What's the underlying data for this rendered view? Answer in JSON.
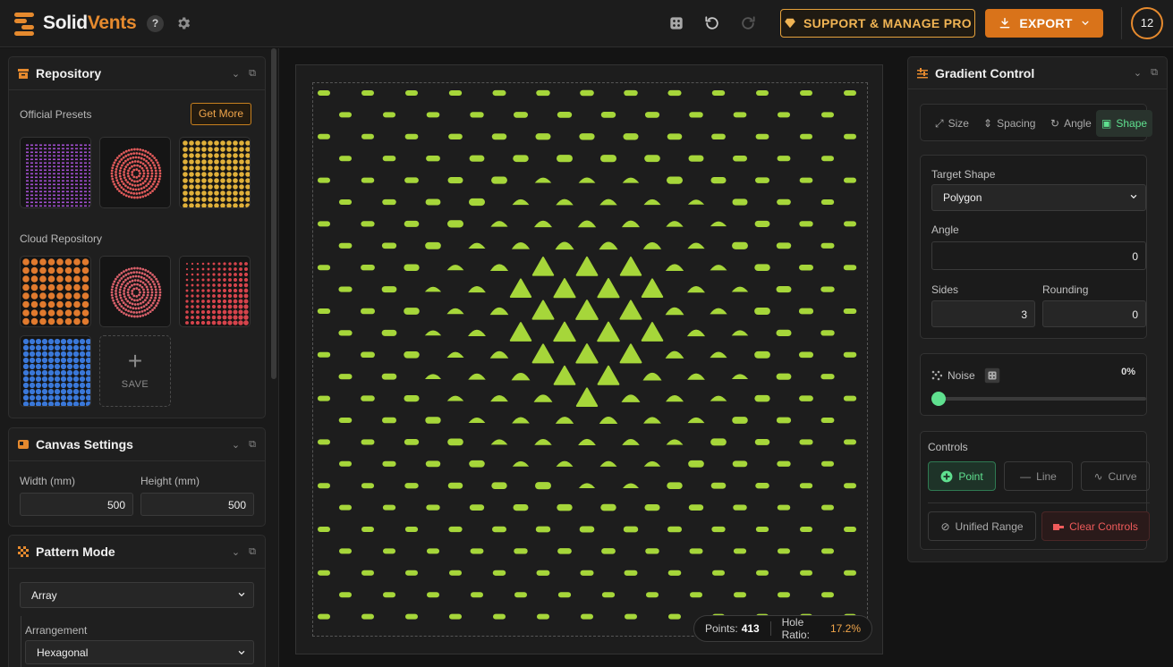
{
  "app": {
    "name_a": "Solid",
    "name_b": "Vents",
    "help": "?",
    "notification_count": "12"
  },
  "toolbar": {
    "support_label": "SUPPORT & MANAGE PRO",
    "export_label": "EXPORT"
  },
  "repository": {
    "title": "Repository",
    "official_label": "Official Presets",
    "get_more": "Get More",
    "cloud_label": "Cloud Repository",
    "save_label": "SAVE"
  },
  "canvas_settings": {
    "title": "Canvas Settings",
    "width_label": "Width (mm)",
    "height_label": "Height (mm)",
    "width": "500",
    "height": "500"
  },
  "pattern_mode": {
    "title": "Pattern Mode",
    "mode": "Array",
    "arrangement_label": "Arrangement",
    "arrangement": "Hexagonal"
  },
  "status": {
    "points_label": "Points:",
    "points": "413",
    "ratio_label": "Hole Ratio:",
    "ratio": "17.2%"
  },
  "gradient": {
    "title": "Gradient Control",
    "tabs": [
      {
        "label": "Size"
      },
      {
        "label": "Spacing"
      },
      {
        "label": "Angle"
      },
      {
        "label": "Shape"
      }
    ],
    "active_tab": "Shape",
    "target_shape_label": "Target Shape",
    "target_shape": "Polygon",
    "angle_label": "Angle",
    "angle": "0",
    "sides_label": "Sides",
    "sides": "3",
    "rounding_label": "Rounding",
    "rounding": "0",
    "noise_label": "Noise",
    "noise_value": "0%",
    "noise_level": 0,
    "controls_label": "Controls",
    "btn_point": "Point",
    "btn_line": "Line",
    "btn_curve": "Curve",
    "btn_unified": "Unified Range",
    "btn_clear": "Clear Controls"
  },
  "colors": {
    "accent": "#e68a2e",
    "pattern": "#a6d63a",
    "active_green": "#5fe08f",
    "danger": "#ef5b5b"
  }
}
